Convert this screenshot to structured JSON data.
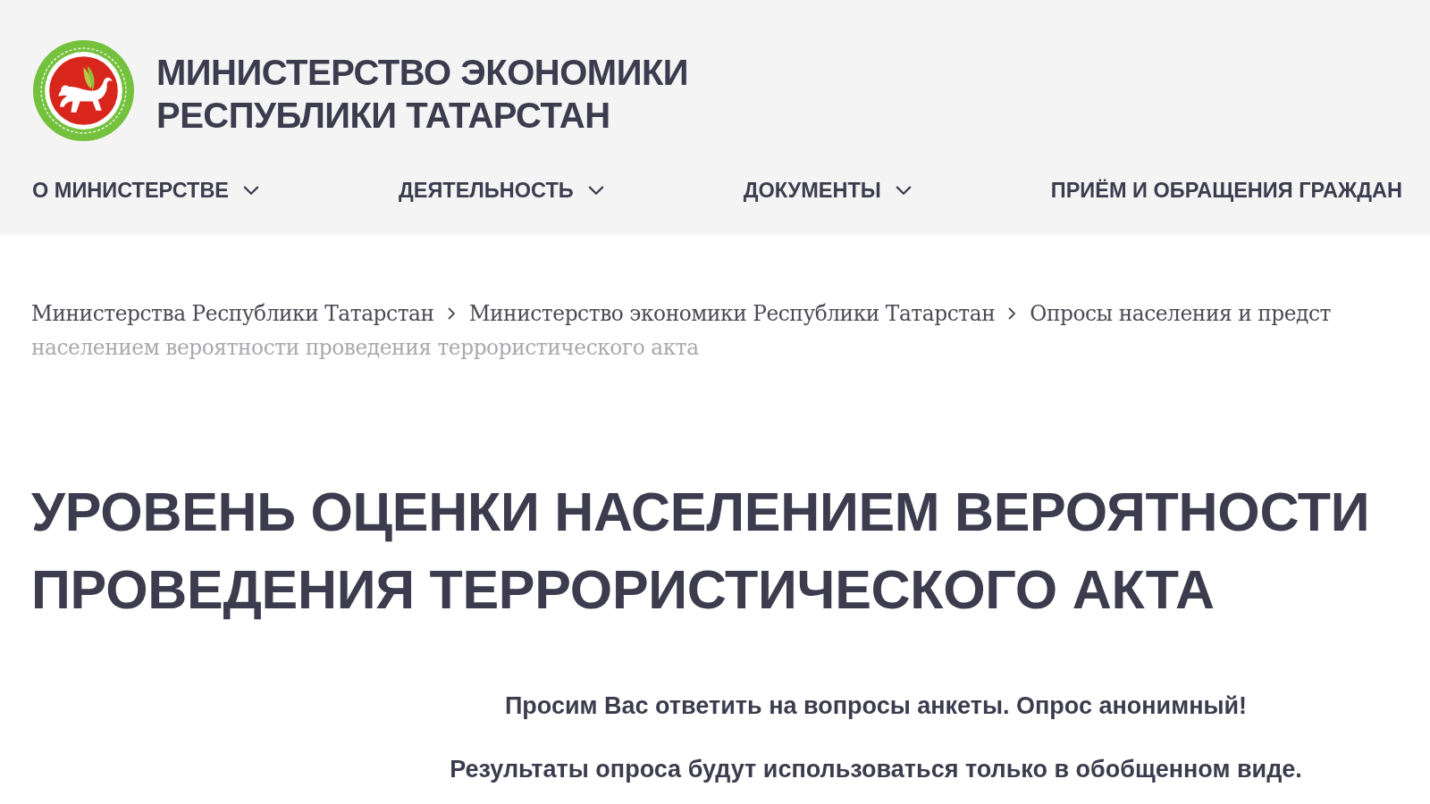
{
  "header": {
    "title": "МИНИСТЕРСТВО ЭКОНОМИКИ РЕСПУБЛИКИ ТАТАРСТАН"
  },
  "nav": {
    "items": [
      {
        "label": "О МИНИСТЕРСТВЕ",
        "has_dropdown": true
      },
      {
        "label": "ДЕЯТЕЛЬНОСТЬ",
        "has_dropdown": true
      },
      {
        "label": "ДОКУМЕНТЫ",
        "has_dropdown": true
      },
      {
        "label": "ПРИЁМ И ОБРАЩЕНИЯ ГРАЖДАН",
        "has_dropdown": false
      }
    ]
  },
  "breadcrumbs": {
    "items": [
      "Министерства Республики Татарстан",
      "Министерство экономики Республики Татарстан",
      "Опросы населения и предст"
    ],
    "current": "населением вероятности проведения террористического акта"
  },
  "heading": "УРОВЕНЬ ОЦЕНКИ НАСЕЛЕНИЕМ ВЕРОЯТНОСТИ ПРОВЕДЕНИЯ ТЕРРОРИСТИЧЕСКОГО АКТА",
  "intro": [
    "Просим Вас ответить на вопросы анкеты. Опрос анонимный!",
    "Результаты опроса будут использоваться только в обобщенном виде."
  ]
}
